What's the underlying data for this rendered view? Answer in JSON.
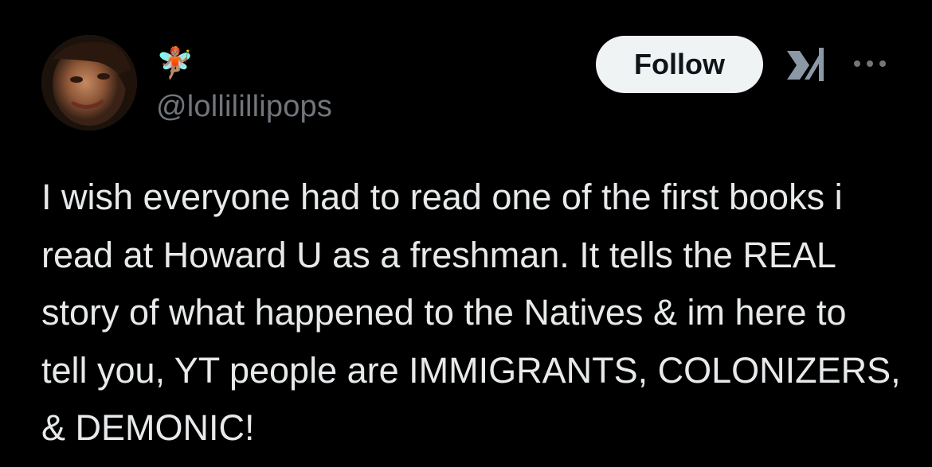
{
  "author": {
    "display_name": "🧚🏽",
    "handle": "@lollilillipops"
  },
  "actions": {
    "follow_label": "Follow",
    "grok_icon": "grok-icon",
    "more_icon": "more-options-icon"
  },
  "tweet": {
    "text": "I wish everyone had to read one of the first books i read at Howard U as a freshman. It tells the REAL story of what happened to the Natives & im here to tell you, YT people are IMMIGRANTS, COLONIZERS, & DEMONIC!"
  },
  "colors": {
    "background": "#000000",
    "text_primary": "#e7e9ea",
    "text_secondary": "#71767b",
    "button_bg": "#eff3f4",
    "button_text": "#0f1419"
  }
}
